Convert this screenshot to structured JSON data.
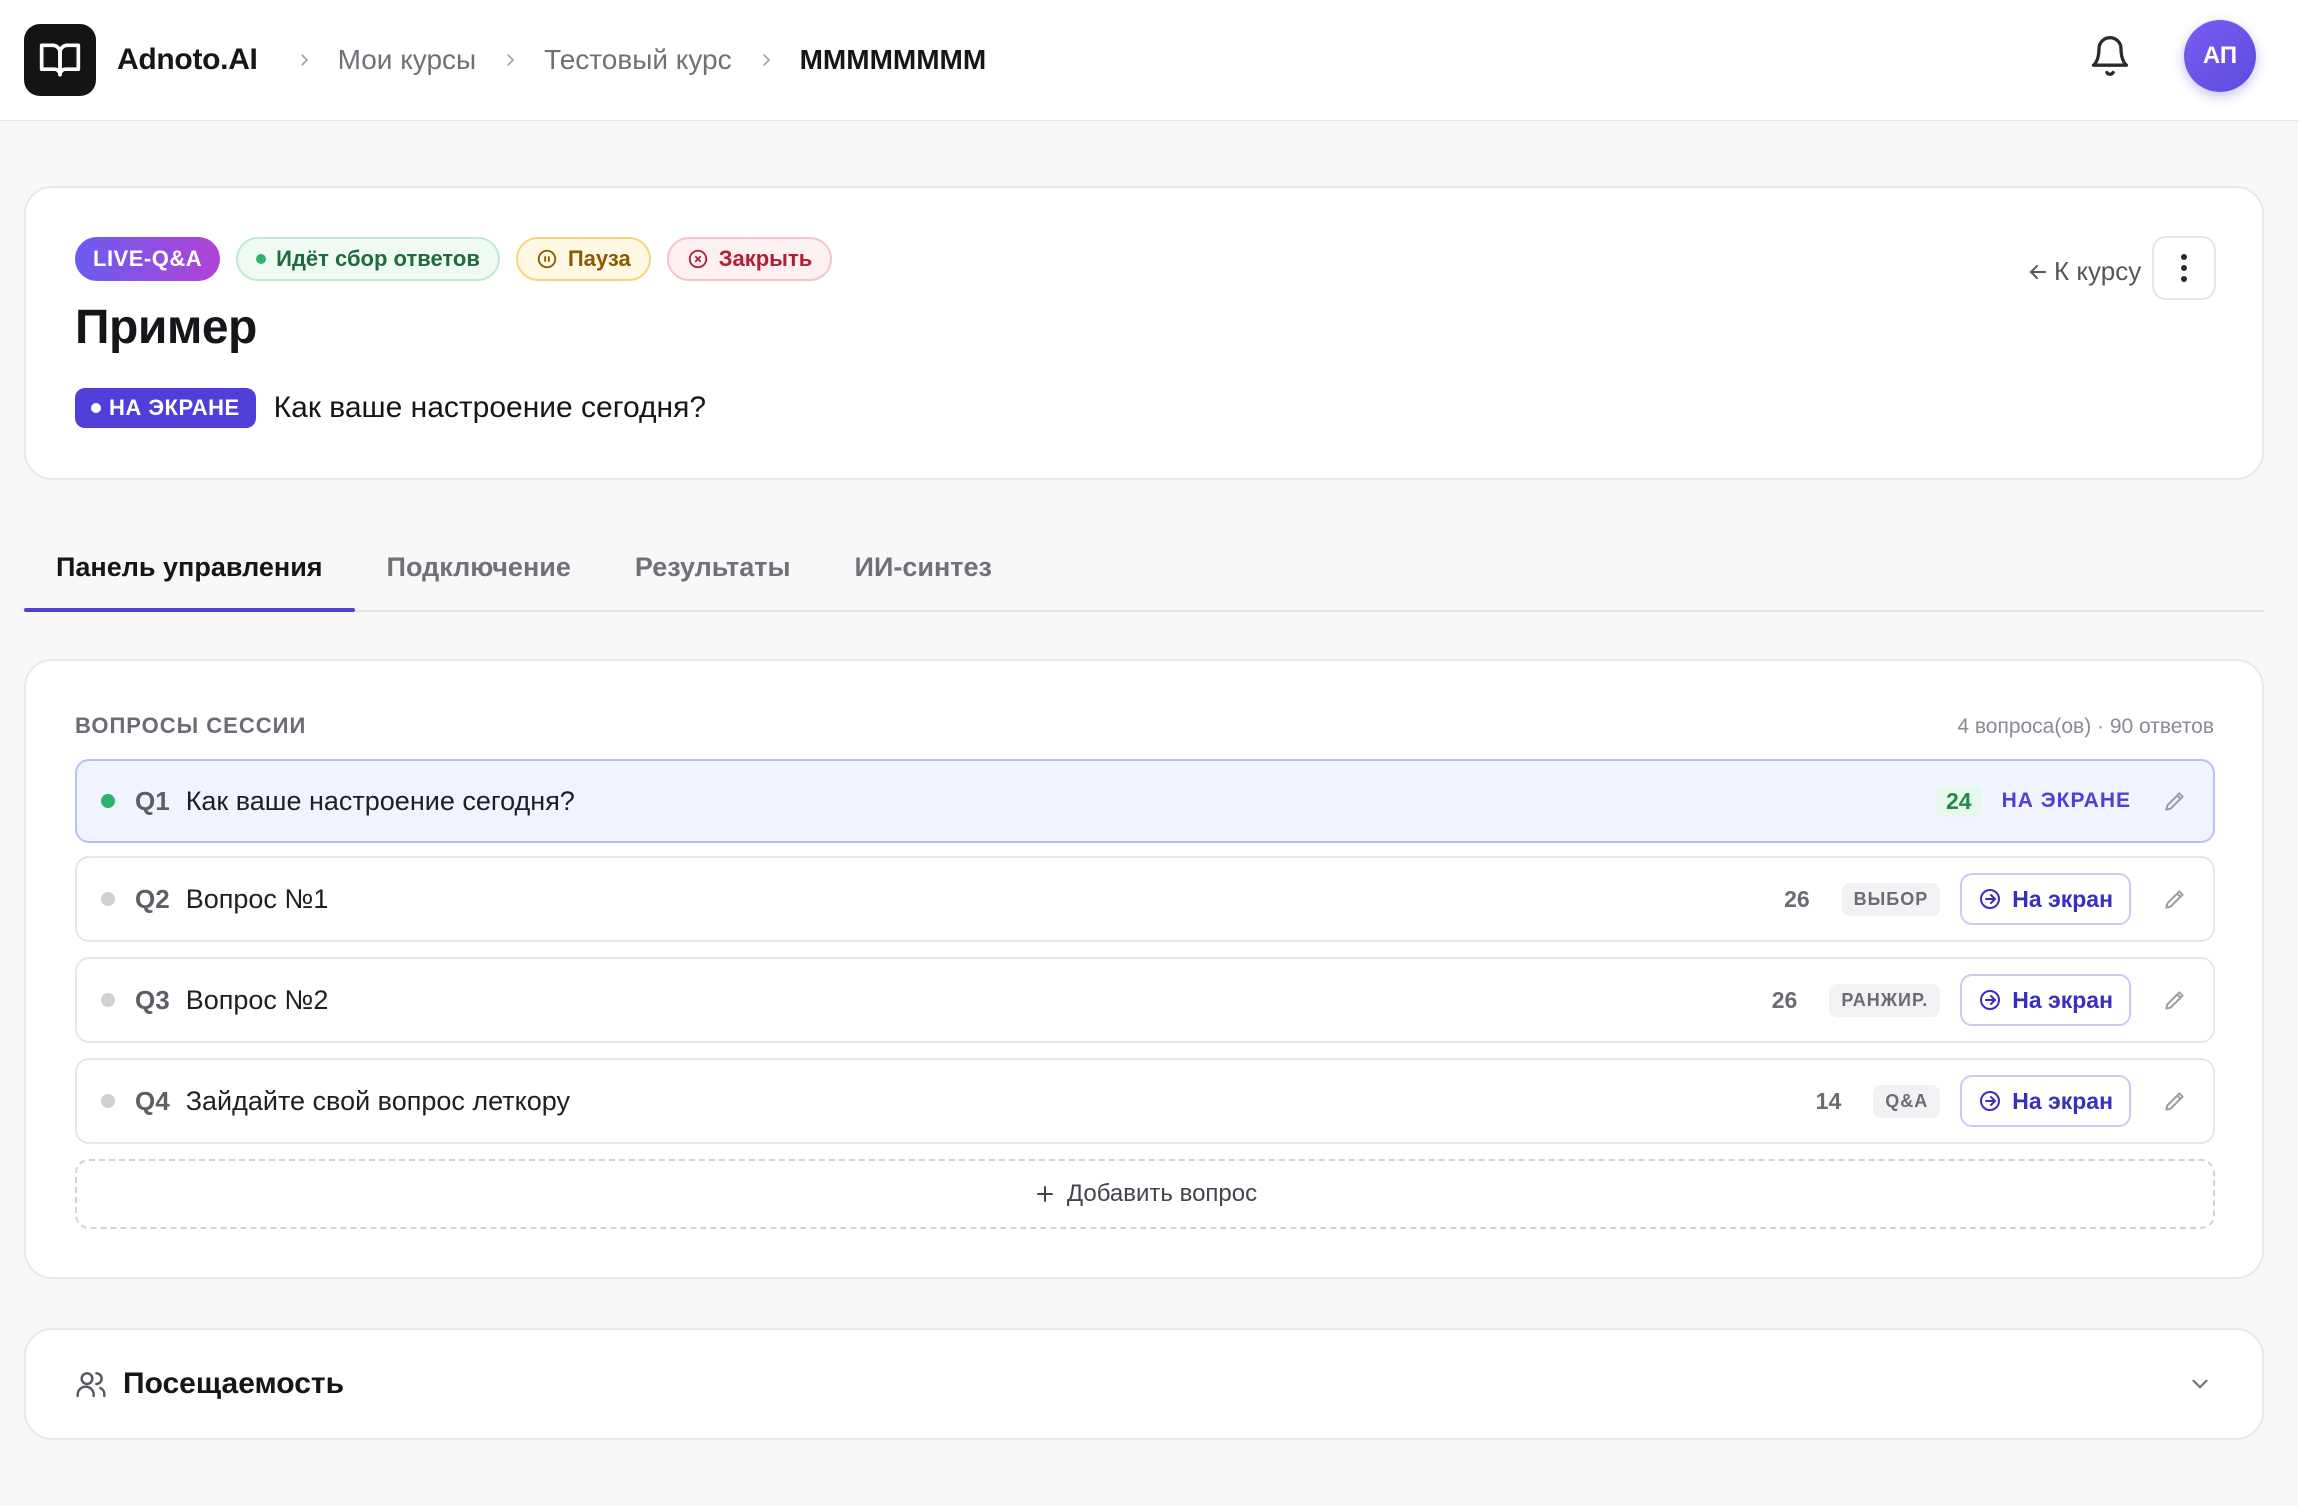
{
  "brand": "Adnoto.AI",
  "breadcrumbs": [
    "Мои курсы",
    "Тестовый курс",
    "ММММММММ"
  ],
  "avatar_initials": "АП",
  "session": {
    "badge_live": "LIVE-Q&A",
    "badge_collecting": "Идёт сбор ответов",
    "badge_pause": "Пауза",
    "badge_close": "Закрыть",
    "title": "Пример",
    "onscreen_badge": "НА ЭКРАНЕ",
    "onscreen_question": "Как ваше настроение сегодня?",
    "back_label": "К курсу"
  },
  "tabs": [
    "Панель управления",
    "Подключение",
    "Результаты",
    "ИИ-синтез"
  ],
  "questions_panel": {
    "heading": "ВОПРОСЫ СЕССИИ",
    "meta": "4 вопроса(ов) · 90 ответов",
    "items": [
      {
        "num": "Q1",
        "text": "Как ваше настроение сегодня?",
        "count": "24",
        "status": "НА ЭКРАНЕ"
      },
      {
        "num": "Q2",
        "text": "Вопрос №1",
        "count": "26",
        "type": "ВЫБОР",
        "button": "На экран"
      },
      {
        "num": "Q3",
        "text": "Вопрос №2",
        "count": "26",
        "type": "РАНЖИР.",
        "button": "На экран"
      },
      {
        "num": "Q4",
        "text": "Зайдайте свой вопрос леткору",
        "count": "14",
        "type": "Q&A",
        "button": "На экран"
      }
    ],
    "add_label": "Добавить вопрос"
  },
  "attendance": {
    "title": "Посещаемость"
  },
  "colors": {
    "accent": "#4f3fd8",
    "success": "#2fb36c",
    "danger": "#b41d36",
    "warning": "#8a5a00"
  },
  "icons": [
    "book-icon",
    "chevron-right-icon",
    "bell-icon",
    "pause-icon",
    "close-circle-icon",
    "arrow-left-icon",
    "kebab-icon",
    "arrow-right-circle-icon",
    "pencil-icon",
    "plus-icon",
    "users-icon",
    "chevron-down-icon"
  ]
}
